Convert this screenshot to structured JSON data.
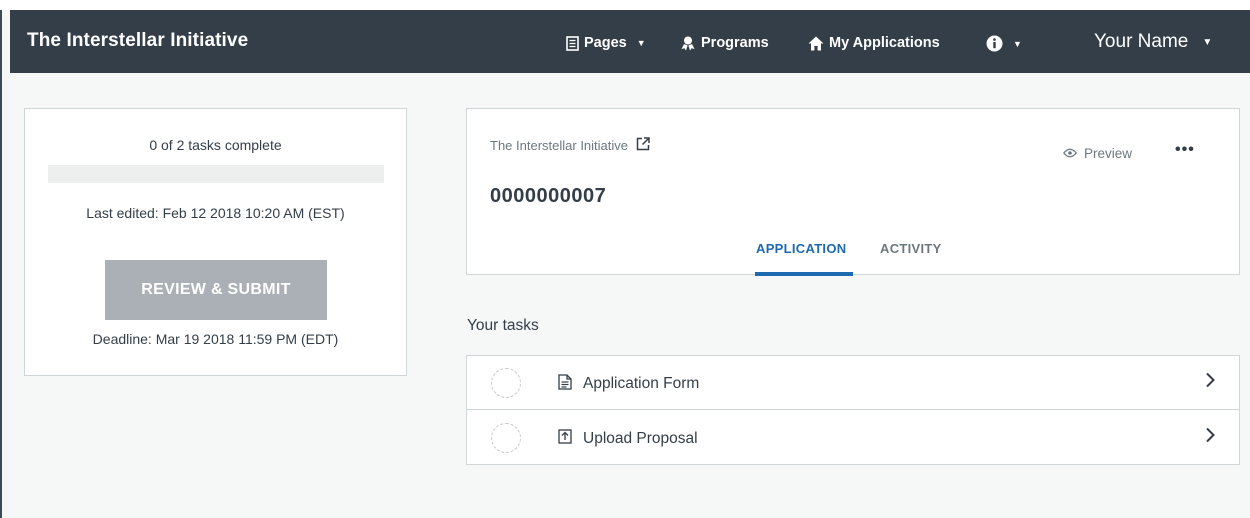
{
  "navbar": {
    "brand": "The Interstellar Initiative",
    "pages_label": "Pages",
    "programs_label": "Programs",
    "applications_label": "My Applications",
    "user_name": "Your Name",
    "icons": {
      "pages": "document-icon",
      "programs": "award-icon",
      "applications": "home-icon",
      "info": "info-icon",
      "dropdown": "caret-down-icon"
    }
  },
  "status": {
    "tasks_complete": "0 of 2 tasks complete",
    "progress_fraction": 0,
    "last_edited": "Last edited: Feb 12 2018 10:20 AM (EST)",
    "review_button": "REVIEW & SUBMIT",
    "deadline": "Deadline: Mar 19 2018 11:59 PM (EDT)"
  },
  "application": {
    "program_name": "The Interstellar Initiative",
    "number": "0000000007",
    "preview_label": "Preview",
    "more_label": "•••",
    "tabs": [
      {
        "label": "APPLICATION",
        "active": true
      },
      {
        "label": "ACTIVITY",
        "active": false
      }
    ]
  },
  "tasks": {
    "heading": "Your tasks",
    "items": [
      {
        "label": "Application Form",
        "icon": "form-document-icon",
        "complete": false
      },
      {
        "label": "Upload Proposal",
        "icon": "upload-icon",
        "complete": false
      }
    ]
  },
  "colors": {
    "navbar": "#333e48",
    "accent": "#1e6ab0",
    "button_disabled": "#aab0b5",
    "background": "#f6f8f8"
  }
}
